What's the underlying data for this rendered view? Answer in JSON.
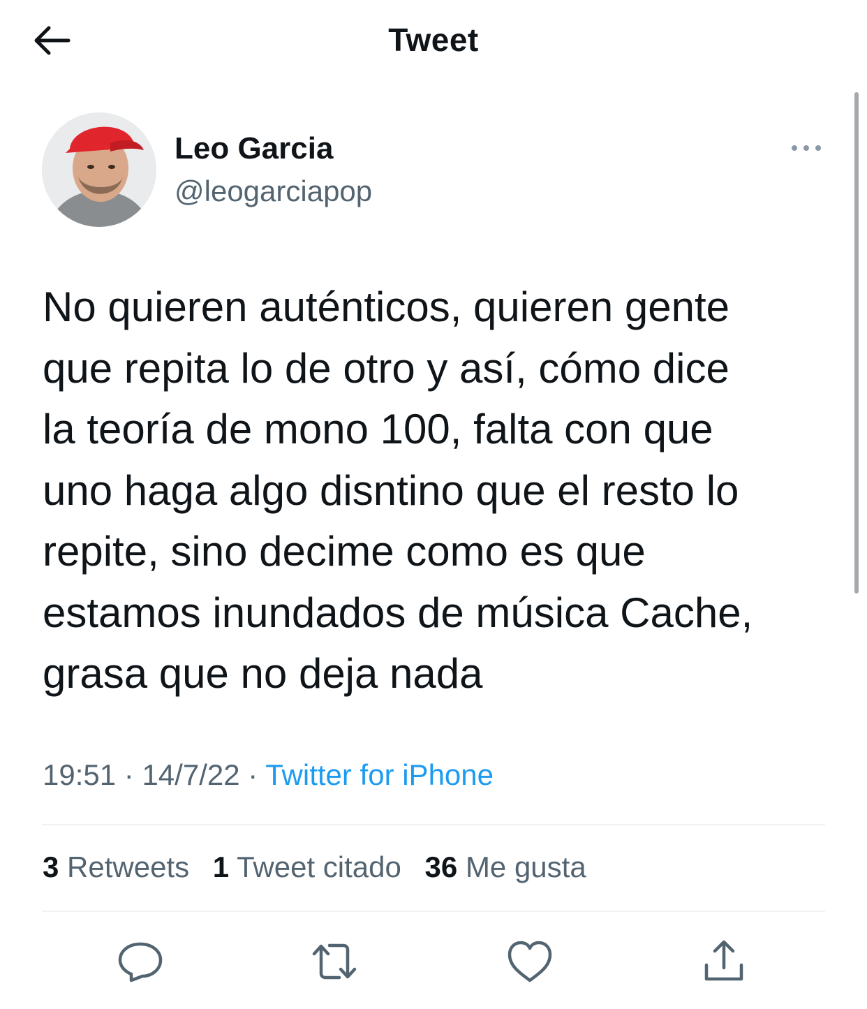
{
  "header": {
    "title": "Tweet",
    "back_icon": "arrow-left-icon"
  },
  "author": {
    "name": "Leo Garcia",
    "handle": "@leogarciapop"
  },
  "tweet": {
    "text": "No quieren auténticos, quieren gente\nque repita lo de otro y así, cómo dice\nla teoría de mono 100, falta con que\nuno haga algo disntino que el resto lo\nrepite, sino decime como es que\nestamos inundados de música Cache,\ngrasa que no deja nada",
    "time": "19:51",
    "sep1": "·",
    "date": "14/7/22",
    "sep2": "·",
    "source": "Twitter for iPhone"
  },
  "stats": {
    "retweets_count": "3",
    "retweets_label": "Retweets",
    "quotes_count": "1",
    "quotes_label": "Tweet citado",
    "likes_count": "36",
    "likes_label": "Me gusta"
  },
  "colors": {
    "text": "#0f1419",
    "secondary": "#536471",
    "accent": "#1d9bf0",
    "divider": "#eff3f4"
  },
  "icons": [
    "arrow-left-icon",
    "more-icon",
    "reply-icon",
    "retweet-icon",
    "like-icon",
    "share-icon"
  ]
}
